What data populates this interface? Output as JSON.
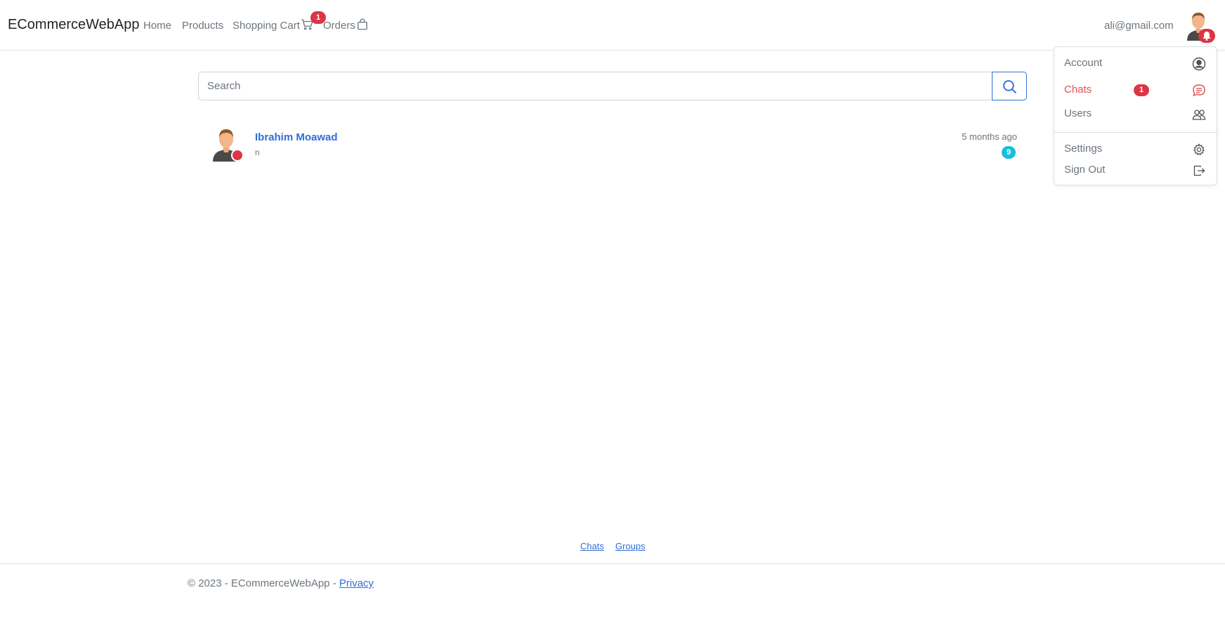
{
  "navbar": {
    "brand": "ECommerceWebApp",
    "links": {
      "home": "Home",
      "products": "Products",
      "cart": "Shopping Cart",
      "orders": "Orders"
    },
    "cart_count": "1",
    "user_email": "ali@gmail.com",
    "icons": [
      "cart-icon",
      "shopping-bag-icon",
      "bell-icon"
    ]
  },
  "dropdown": {
    "account": "Account",
    "chats": "Chats",
    "chats_count": "1",
    "users": "Users",
    "settings": "Settings",
    "sign_out": "Sign Out",
    "icons": [
      "person-circle-icon",
      "chat-icon",
      "people-icon",
      "gear-icon",
      "sign-out-icon"
    ]
  },
  "search": {
    "placeholder": "Search",
    "value": ""
  },
  "chats": [
    {
      "name": "Ibrahim Moawad",
      "preview": "n",
      "time": "5 months ago",
      "unread": "9"
    }
  ],
  "bottom_links": {
    "chats": "Chats",
    "groups": "Groups"
  },
  "footer": {
    "copyright": "© 2023 - ECommerceWebApp - ",
    "privacy": "Privacy"
  },
  "colors": {
    "accent": "#2f6fd6",
    "danger": "#dc3545",
    "info": "#17c0de",
    "muted": "#6c757d"
  }
}
